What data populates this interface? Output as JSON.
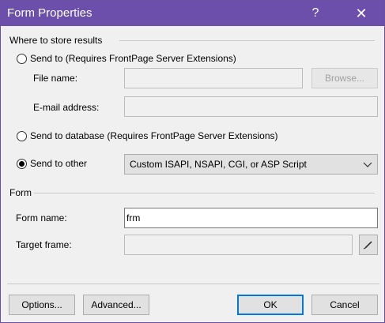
{
  "window": {
    "title": "Form Properties",
    "help_glyph": "?",
    "close_glyph": "✕"
  },
  "store": {
    "section_label": "Where to store results",
    "send_to": {
      "label": "Send to (Requires FrontPage Server Extensions)",
      "checked": false
    },
    "file_name": {
      "label": "File name:",
      "value": ""
    },
    "browse_button": "Browse...",
    "email": {
      "label": "E-mail address:",
      "value": ""
    },
    "send_to_database": {
      "label": "Send to database (Requires FrontPage Server Extensions)",
      "checked": false
    },
    "send_to_other": {
      "label": "Send to other",
      "checked": true,
      "selected_option": "Custom ISAPI, NSAPI, CGI, or ASP Script"
    }
  },
  "form": {
    "section_label": "Form",
    "form_name": {
      "label": "Form name:",
      "value": "frm"
    },
    "target_frame": {
      "label": "Target frame:",
      "value": ""
    }
  },
  "footer": {
    "options": "Options...",
    "advanced": "Advanced...",
    "ok": "OK",
    "cancel": "Cancel"
  },
  "colors": {
    "titlebar": "#6b4faa",
    "focus_border": "#0078d7"
  }
}
